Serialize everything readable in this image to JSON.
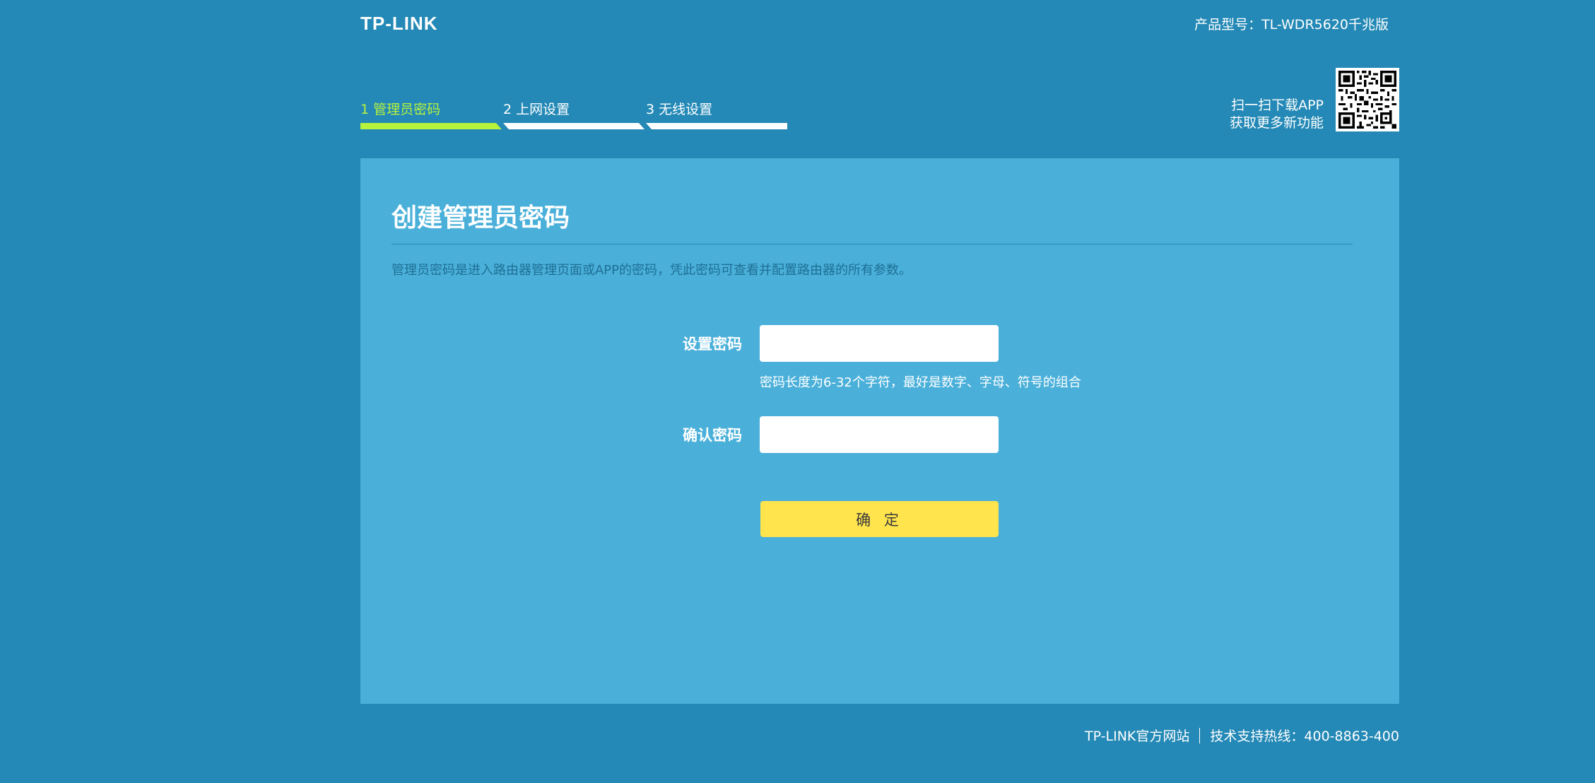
{
  "header": {
    "logo": "TP-LINK",
    "model": "产品型号：TL-WDR5620千兆版"
  },
  "steps": [
    {
      "label": "1 管理员密码",
      "active": true
    },
    {
      "label": "2 上网设置",
      "active": false
    },
    {
      "label": "3 无线设置",
      "active": false
    }
  ],
  "qr": {
    "line1": "扫一扫下载APP",
    "line2": "获取更多新功能"
  },
  "panel": {
    "title": "创建管理员密码",
    "description": "管理员密码是进入路由器管理页面或APP的密码，凭此密码可查看并配置路由器的所有参数。",
    "password_label": "设置密码",
    "password_value": "",
    "password_hint": "密码长度为6-32个字符，最好是数字、字母、符号的组合",
    "confirm_label": "确认密码",
    "confirm_value": "",
    "submit_label": "确 定"
  },
  "footer": {
    "site_link": "TP-LINK官方网站",
    "hotline": "技术支持热线：400-8863-400"
  },
  "colors": {
    "background": "#2489b6",
    "panel": "#4ab0d9",
    "active_step": "#b7f23d",
    "button": "#ffe44d"
  }
}
